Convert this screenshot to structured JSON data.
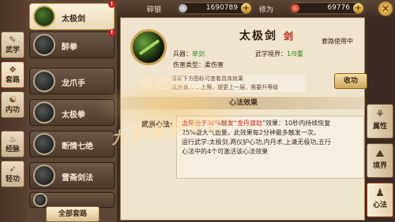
{
  "categories": [
    {
      "label": "武学",
      "glyph": "✎",
      "active": false
    },
    {
      "label": "套路",
      "glyph": "❖",
      "active": true
    },
    {
      "label": "内功",
      "glyph": "☯",
      "active": false
    },
    {
      "label": "经脉",
      "glyph": "♨",
      "active": false
    },
    {
      "label": "轻功",
      "glyph": "➶",
      "active": false
    }
  ],
  "skills": [
    {
      "name": "太极剑",
      "active": true,
      "alert": true
    },
    {
      "name": "醉拳",
      "active": false,
      "alert": true
    },
    {
      "name": "龙爪手",
      "active": false,
      "alert": false
    },
    {
      "name": "太极拳",
      "active": false,
      "alert": false
    },
    {
      "name": "断情七绝",
      "active": false,
      "alert": false
    },
    {
      "name": "雪斋剑法",
      "active": false,
      "alert": false
    },
    {
      "name": "",
      "active": false,
      "alert": false
    }
  ],
  "all_routes_label": "全部套路",
  "resources": {
    "silver_label": "碎银",
    "silver_value": "1690789",
    "cultivation_label": "修为",
    "cultivation_value": "69776",
    "plus": "+"
  },
  "close_glyph": "✕",
  "skill": {
    "title": "太极剑",
    "seal": "剑",
    "route_status": "套路使用中",
    "weapon_label": "兵器：",
    "weapon_value": "单剑",
    "realm_label": "武学境界：",
    "realm_value": "1/9重",
    "damage_label": "伤害类型：",
    "damage_value": "柔伤害",
    "hint_line1": "逐级下方图标可查看具体效果",
    "hint_line2": "武当派…    …上限，提更上一层，需要升等级"
  },
  "collect_label": "收功",
  "heart_title": "心法效果",
  "method_label": "武当心法:",
  "effect": {
    "line1_a": "血量低于30%触发“",
    "line1_hl": "金丹渡劫",
    "line1_b": "”效果：10秒内持续恢复",
    "line2": "25%最大气血量，此效果每2分钟最多触发一次。",
    "line3": "运行武学:太极剑,两仪护心功,内丹术,上清无极功,五行",
    "line4": "心法中的4个可激活该心法效果"
  },
  "watermark_top": "搞趣网",
  "watermark": "九阴真经专区",
  "side_tabs": [
    {
      "label": "属性",
      "glyph": "⚘",
      "active": false
    },
    {
      "label": "境界",
      "glyph": "⛰",
      "active": false
    },
    {
      "label": "心法",
      "glyph": "♟",
      "active": true
    }
  ]
}
